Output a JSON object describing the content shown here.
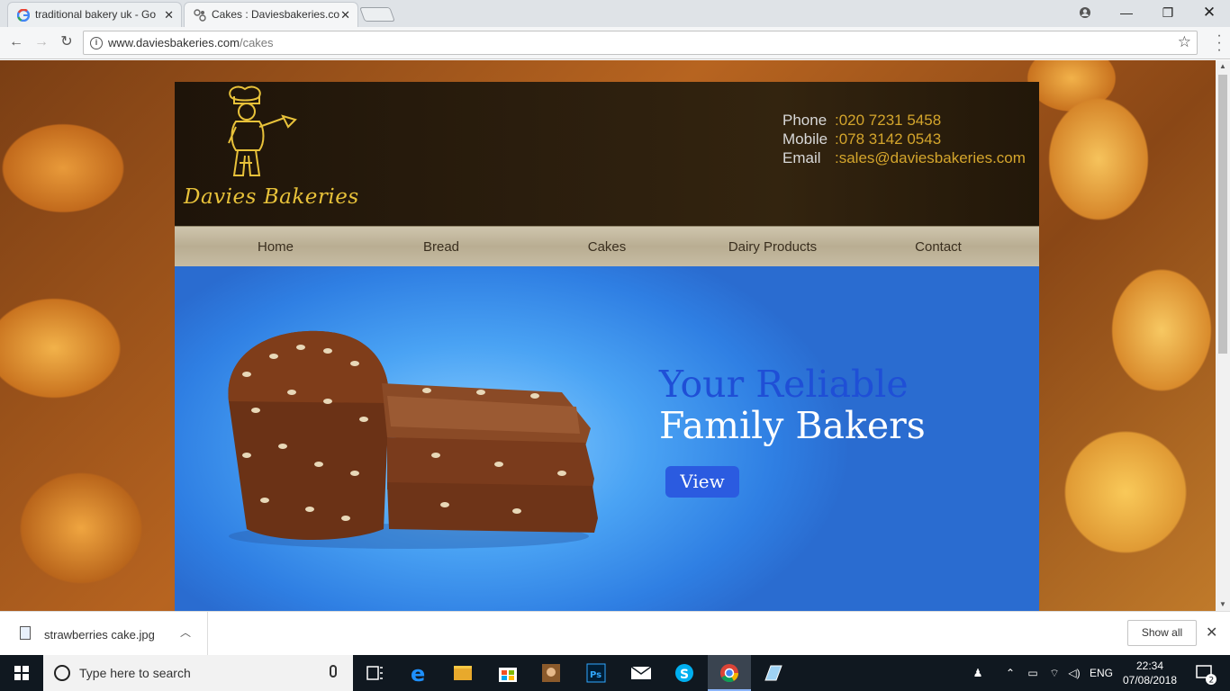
{
  "browser": {
    "tabs": [
      {
        "title": "traditional bakery uk - Go",
        "favicon": "google-g-icon",
        "active": false
      },
      {
        "title": "Cakes : Daviesbakeries.co",
        "favicon": "puzzle-icon",
        "active": true
      }
    ],
    "address": {
      "host": "www.daviesbakeries.com",
      "path": "/cakes"
    }
  },
  "site": {
    "logo_text": "Davies Bakeries",
    "contact": {
      "phone_label": "Phone",
      "phone": ":020 7231 5458",
      "mobile_label": "Mobile",
      "mobile": ":078 3142 0543",
      "email_label": "Email",
      "email": ":sales@daviesbakeries.com"
    },
    "nav": [
      "Home",
      "Bread",
      "Cakes",
      "Dairy Products",
      "Contact"
    ],
    "hero": {
      "line1": "Your Reliable",
      "line2": "Family Bakers",
      "button": "View"
    }
  },
  "downloads": {
    "file": "strawberries cake.jpg",
    "show_all": "Show all"
  },
  "taskbar": {
    "search_placeholder": "Type here to search",
    "language": "ENG",
    "time": "22:34",
    "date": "07/08/2018",
    "notification_count": "2"
  },
  "colors": {
    "hero_blue": "#2f7fe3",
    "tagline_blue": "#1f4fd6",
    "gold": "#d4a52c"
  }
}
